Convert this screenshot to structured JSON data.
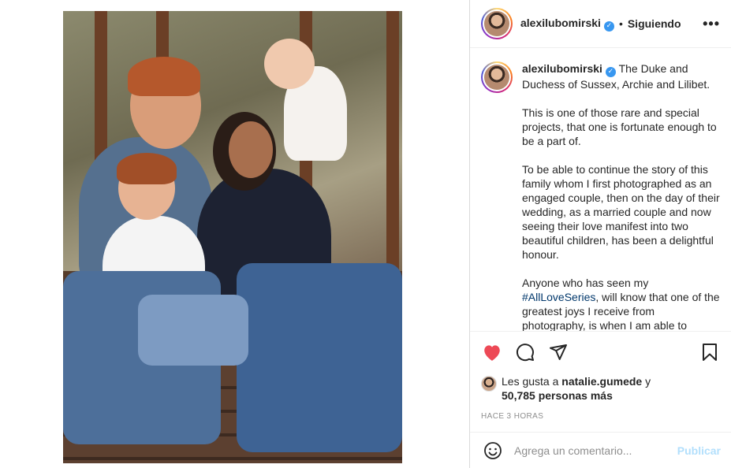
{
  "post": {
    "username": "alexilubomirski",
    "follow_status": "Siguiendo",
    "dot": "•",
    "more": "•••",
    "caption": {
      "p1": "The Duke and Duchess of Sussex, Archie and Lilibet.",
      "p2": "This is one of those rare and special projects, that one is fortunate enough to be a part of.",
      "p3": "To be able to continue the story of this family whom I first photographed as an engaged couple, then on the day of their wedding, as a married couple and now seeing their love manifest into two beautiful children, has been a delightful honour.",
      "p4_before": "Anyone who has seen my ",
      "hashtag": "#AllLoveSeries",
      "p4_after": ", will know that one of the greatest joys I receive from photography, is when I am able to"
    },
    "likes": {
      "prefix": "Les gusta a ",
      "liker": "natalie.gumede",
      "joiner": " y",
      "count_text": "50,785 personas más"
    },
    "timestamp": "Hace 3 horas",
    "comment": {
      "placeholder": "Agrega un comentario...",
      "publish_label": "Publicar"
    },
    "icons": {
      "like": "heart-icon",
      "comment": "comment-icon",
      "share": "paper-plane-icon",
      "save": "bookmark-icon",
      "emoji": "emoji-icon",
      "verified": "verified-badge-icon"
    },
    "colors": {
      "like_active": "#ed4956",
      "verified": "#3897f0",
      "hashtag": "#00376b",
      "publish_disabled": "#b2dffc"
    }
  }
}
